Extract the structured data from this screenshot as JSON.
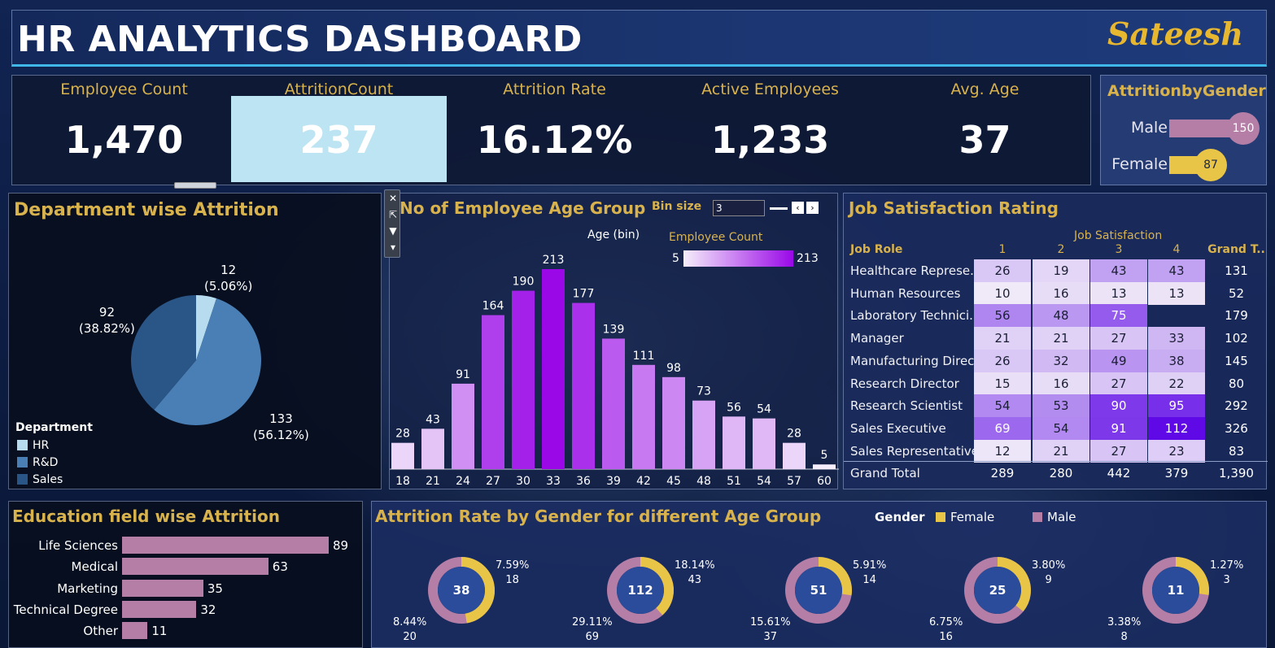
{
  "header": {
    "title": "HR ANALYTICS DASHBOARD",
    "author": "Sateesh"
  },
  "kpis": [
    {
      "label": "Employee Count",
      "value": "1,470"
    },
    {
      "label": "AttritionCount",
      "value": "237"
    },
    {
      "label": "Attrition Rate",
      "value": "16.12%"
    },
    {
      "label": "Active Employees",
      "value": "1,233"
    },
    {
      "label": "Avg. Age",
      "value": "37"
    }
  ],
  "gender": {
    "title": "AttritionbyGender",
    "rows": [
      {
        "label": "Male",
        "value": "150",
        "color": "#b47ea6"
      },
      {
        "label": "Female",
        "value": "87",
        "color": "#e8c547"
      }
    ]
  },
  "department": {
    "title": "Department wise Attrition",
    "legend_title": "Department",
    "slices": [
      {
        "name": "HR",
        "value": 12,
        "label": "12",
        "pct": "(5.06%)",
        "color": "#b7dcf0"
      },
      {
        "name": "R&D",
        "value": 133,
        "label": "133",
        "pct": "(56.12%)",
        "color": "#4a7fb5"
      },
      {
        "name": "Sales",
        "value": 92,
        "label": "92",
        "pct": "(38.82%)",
        "color": "#2a5587"
      }
    ]
  },
  "age_group": {
    "title": "No of Employee Age Group",
    "bin_label": "Bin size",
    "bin_value": "3",
    "axis_label": "Age (bin)",
    "legend_title": "Employee Count",
    "legend_min": "5",
    "legend_max": "213",
    "chart_data": {
      "type": "bar",
      "categories": [
        "18",
        "21",
        "24",
        "27",
        "30",
        "33",
        "36",
        "39",
        "42",
        "45",
        "48",
        "51",
        "54",
        "57",
        "60"
      ],
      "values": [
        28,
        43,
        91,
        164,
        190,
        213,
        177,
        139,
        111,
        98,
        73,
        56,
        54,
        28,
        5
      ],
      "xlabel": "Age (bin)"
    }
  },
  "job": {
    "title": "Job Satisfaction Rating",
    "col_group": "Job Satisfaction",
    "role_header": "Job Role",
    "columns": [
      "1",
      "2",
      "3",
      "4",
      "Grand T.."
    ],
    "rows": [
      {
        "role": "Healthcare Represe..",
        "cells": [
          "26",
          "19",
          "43",
          "43",
          "131"
        ]
      },
      {
        "role": "Human Resources",
        "cells": [
          "10",
          "16",
          "13",
          "13",
          "52"
        ]
      },
      {
        "role": "Laboratory Technici..",
        "cells": [
          "56",
          "48",
          "75",
          "",
          "179"
        ]
      },
      {
        "role": "Manager",
        "cells": [
          "21",
          "21",
          "27",
          "33",
          "102"
        ]
      },
      {
        "role": "Manufacturing Direc..",
        "cells": [
          "26",
          "32",
          "49",
          "38",
          "145"
        ]
      },
      {
        "role": "Research Director",
        "cells": [
          "15",
          "16",
          "27",
          "22",
          "80"
        ]
      },
      {
        "role": "Research Scientist",
        "cells": [
          "54",
          "53",
          "90",
          "95",
          "292"
        ]
      },
      {
        "role": "Sales Executive",
        "cells": [
          "69",
          "54",
          "91",
          "112",
          "326"
        ]
      },
      {
        "role": "Sales Representative",
        "cells": [
          "12",
          "21",
          "27",
          "23",
          "83"
        ]
      }
    ],
    "total": {
      "role": "Grand Total",
      "cells": [
        "289",
        "280",
        "442",
        "379",
        "1,390"
      ]
    }
  },
  "education": {
    "title": "Education field wise Attrition",
    "chart_data": {
      "type": "bar",
      "categories": [
        "Life Sciences",
        "Medical",
        "Marketing",
        "Technical Degree",
        "Other"
      ],
      "values": [
        89,
        63,
        35,
        32,
        11
      ]
    }
  },
  "gender_age": {
    "title": "Attrition Rate by Gender for different Age Group",
    "legend_title": "Gender",
    "legend": [
      {
        "name": "Female",
        "color": "#e8c547"
      },
      {
        "name": "Male",
        "color": "#b47ea6"
      }
    ],
    "chart_data": {
      "type": "pie",
      "groups": [
        {
          "center": "38",
          "female_pct": "7.59%",
          "female": 18,
          "male_pct": "8.44%",
          "male": 20
        },
        {
          "center": "112",
          "female_pct": "18.14%",
          "female": 43,
          "male_pct": "29.11%",
          "male": 69
        },
        {
          "center": "51",
          "female_pct": "5.91%",
          "female": 14,
          "male_pct": "15.61%",
          "male": 37
        },
        {
          "center": "25",
          "female_pct": "3.80%",
          "female": 9,
          "male_pct": "6.75%",
          "male": 16
        },
        {
          "center": "11",
          "female_pct": "1.27%",
          "female": 3,
          "male_pct": "3.38%",
          "male": 8
        }
      ]
    }
  }
}
